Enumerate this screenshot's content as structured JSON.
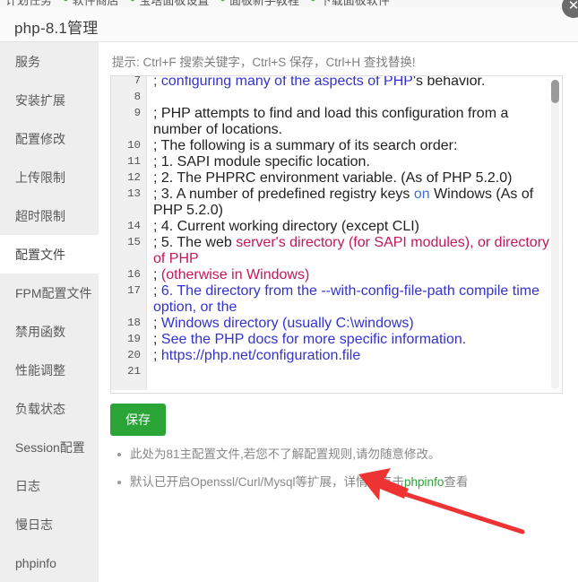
{
  "topmenu": {
    "items": [
      {
        "label": "计划任务",
        "icon": "none"
      },
      {
        "label": "软件商店",
        "icon": "dot-icon"
      },
      {
        "label": "宝塔面板设置",
        "icon": "dot-icon"
      },
      {
        "label": "面板新手教程",
        "icon": "dot-icon"
      },
      {
        "label": "下载面板软件",
        "icon": "dot-icon"
      }
    ]
  },
  "header": {
    "title": "php-8.1管理",
    "close_label": "✕"
  },
  "sidebar": {
    "items": [
      {
        "label": "服务",
        "active": false
      },
      {
        "label": "安装扩展",
        "active": false
      },
      {
        "label": "配置修改",
        "active": false
      },
      {
        "label": "上传限制",
        "active": false
      },
      {
        "label": "超时限制",
        "active": false
      },
      {
        "label": "配置文件",
        "active": true
      },
      {
        "label": "FPM配置文件",
        "active": false
      },
      {
        "label": "禁用函数",
        "active": false
      },
      {
        "label": "性能调整",
        "active": false
      },
      {
        "label": "负载状态",
        "active": false
      },
      {
        "label": "Session配置",
        "active": false
      },
      {
        "label": "日志",
        "active": false
      },
      {
        "label": "慢日志",
        "active": false
      },
      {
        "label": "phpinfo",
        "active": false
      }
    ]
  },
  "main": {
    "hint": "提示: Ctrl+F 搜索关键字，Ctrl+S 保存，Ctrl+H 查找替换!",
    "save_label": "保存",
    "notes": [
      {
        "text_before": "此处为81主配置文件,若您不了解配置规则,请勿随意修改。",
        "link": "",
        "text_after": ""
      },
      {
        "text_before": "默认已开启Openssl/Curl/Mysql等扩展，详情可点击",
        "link": "phpinfo",
        "text_after": "查看"
      }
    ]
  },
  "editor": {
    "scroll_thumb_position": "top",
    "first_visible_line": 7,
    "last_visible_line": 21,
    "lines": [
      {
        "num": "7",
        "segments": [
          {
            "t": "; configuring many of the aspects of PHP",
            "c": "cmt"
          },
          {
            "t": "'s behavior.",
            "c": "plain"
          }
        ]
      },
      {
        "num": "8",
        "segments": [
          {
            "t": "",
            "c": "plain"
          }
        ]
      },
      {
        "num": "9",
        "segments": [
          {
            "t": "; PHP attempts to find and load this configuration from a number of locations.",
            "c": "plain"
          }
        ]
      },
      {
        "num": "10",
        "segments": [
          {
            "t": "; The following is a summary of its search order:",
            "c": "plain"
          }
        ]
      },
      {
        "num": "11",
        "segments": [
          {
            "t": "; 1. SAPI module specific location.",
            "c": "plain"
          }
        ]
      },
      {
        "num": "12",
        "segments": [
          {
            "t": "; 2. The PHPRC environment variable. (As of PHP 5.2.0)",
            "c": "plain"
          }
        ]
      },
      {
        "num": "13",
        "segments": [
          {
            "t": "; 3. A number of predefined registry keys ",
            "c": "plain"
          },
          {
            "t": "on",
            "c": "kw"
          },
          {
            "t": " Windows (As of PHP 5.2.0)",
            "c": "plain"
          }
        ]
      },
      {
        "num": "14",
        "segments": [
          {
            "t": "; 4. Current working directory (except CLI)",
            "c": "plain"
          }
        ]
      },
      {
        "num": "15",
        "segments": [
          {
            "t": "; 5. The web ",
            "c": "plain"
          },
          {
            "t": "server's directory (for SAPI modules), or directory of PHP",
            "c": "str"
          }
        ]
      },
      {
        "num": "16",
        "segments": [
          {
            "t": "; ",
            "c": "plain"
          },
          {
            "t": "(otherwise in Windows)",
            "c": "pink"
          }
        ]
      },
      {
        "num": "17",
        "segments": [
          {
            "t": "; ",
            "c": "plain"
          },
          {
            "t": "6. The directory from the --with-config-file-path compile time option, or the",
            "c": "cmt"
          }
        ]
      },
      {
        "num": "18",
        "segments": [
          {
            "t": "; ",
            "c": "plain"
          },
          {
            "t": "Windows directory (usually C:\\windows)",
            "c": "cmt"
          }
        ]
      },
      {
        "num": "19",
        "segments": [
          {
            "t": "; ",
            "c": "plain"
          },
          {
            "t": "See the PHP docs for more specific information.",
            "c": "cmt"
          }
        ]
      },
      {
        "num": "20",
        "segments": [
          {
            "t": "; ",
            "c": "plain"
          },
          {
            "t": "https://php.net/configuration.file",
            "c": "cmt"
          }
        ]
      },
      {
        "num": "21",
        "segments": [
          {
            "t": "",
            "c": "plain"
          }
        ]
      }
    ]
  },
  "annotation": {
    "type": "red-arrow",
    "color": "#ee3333",
    "points_to": "phpinfo"
  }
}
